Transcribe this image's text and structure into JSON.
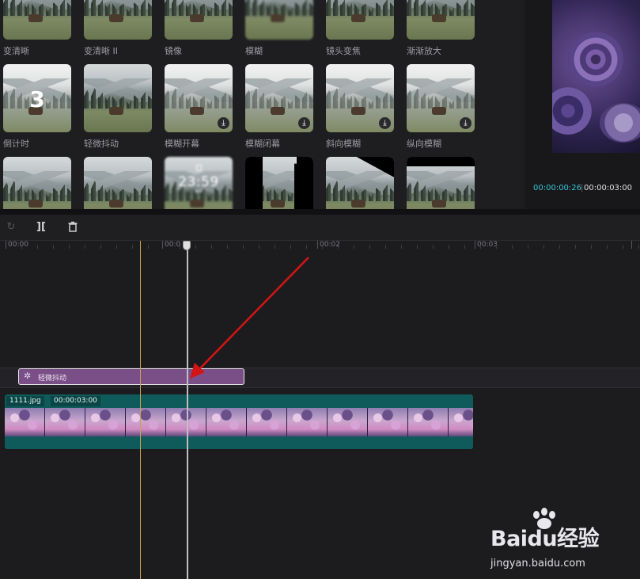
{
  "effects": {
    "rows": [
      [
        {
          "label": "变清晰",
          "style": "plain",
          "download": false
        },
        {
          "label": "变清晰 II",
          "style": "plain",
          "download": false
        },
        {
          "label": "镜像",
          "style": "plain",
          "download": false
        },
        {
          "label": "模糊",
          "style": "blur",
          "download": false
        },
        {
          "label": "镜头变焦",
          "style": "plain",
          "download": false
        },
        {
          "label": "渐渐放大",
          "style": "plain",
          "download": false
        }
      ],
      [
        {
          "label": "倒计时",
          "style": "fog",
          "download": false,
          "overlay": "3"
        },
        {
          "label": "轻微抖动",
          "style": "plain",
          "download": false
        },
        {
          "label": "模糊开幕",
          "style": "fog",
          "download": true
        },
        {
          "label": "模糊闭幕",
          "style": "fog",
          "download": true
        },
        {
          "label": "斜向模糊",
          "style": "fog",
          "download": true
        },
        {
          "label": "纵向模糊",
          "style": "fog",
          "download": true
        }
      ],
      [
        {
          "label": "",
          "style": "plain",
          "download": false
        },
        {
          "label": "",
          "style": "plain",
          "download": false
        },
        {
          "label": "",
          "style": "blur",
          "download": false,
          "clock_time": "23:59",
          "clock_date": "ddd"
        },
        {
          "label": "",
          "style": "cutleft",
          "download": false
        },
        {
          "label": "",
          "style": "diag",
          "download": false
        },
        {
          "label": "",
          "style": "topcut",
          "download": false
        }
      ]
    ]
  },
  "preview": {
    "current_time": "00:00:00:26",
    "separator": "|",
    "total_time": "00:00:03:00"
  },
  "toolbar": {
    "undo_icon": "↻",
    "split_icon": "][",
    "delete_icon": "🗑"
  },
  "ruler": {
    "labels": [
      "00:00",
      "00:0",
      "00:02",
      "00:03"
    ]
  },
  "timeline": {
    "effect_clip_label": "轻微抖动",
    "effect_clip_icon": "✲",
    "video_clip_name": "1111.jpg",
    "video_clip_duration": "00:00:03:00"
  },
  "watermark": {
    "logo": "Baidu经验",
    "url": "jingyan.baidu.com"
  },
  "colors": {
    "effect_clip": "#7a4f88",
    "video_clip": "#0f5a5a",
    "time_current": "#33c5d6",
    "arrow": "#d41414"
  }
}
